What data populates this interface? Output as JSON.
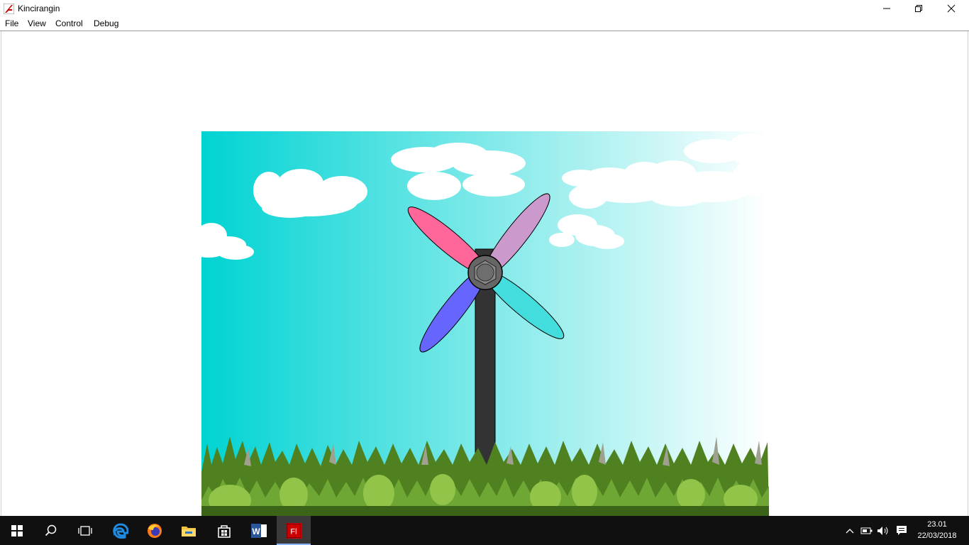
{
  "window": {
    "title": "Kincirangin",
    "controls": {
      "minimize": "minimize-icon",
      "restore": "restore-icon",
      "close": "close-icon"
    }
  },
  "menubar": {
    "items": [
      {
        "label": "File"
      },
      {
        "label": "View"
      },
      {
        "label": "Control"
      },
      {
        "label": "Debug"
      }
    ]
  },
  "scene": {
    "sky_colors": [
      "#00d3d3",
      "#ffffff"
    ],
    "grass_colors": [
      "#4f8120",
      "#6fa734",
      "#93c44a",
      "#3c6418"
    ],
    "blade_colors": [
      "#ff6699",
      "#cc99cc",
      "#6666ff",
      "#44dddd"
    ],
    "pole_color": "#333333",
    "hub_color": "#666666"
  },
  "taskbar": {
    "icons": [
      "windows-start-icon",
      "search-icon",
      "task-view-icon",
      "edge-icon",
      "firefox-icon",
      "file-explorer-icon",
      "store-icon",
      "word-icon",
      "flash-icon"
    ],
    "flash_label": "Fl",
    "word_label": "W",
    "time": "23.01",
    "date": "22/03/2018"
  }
}
